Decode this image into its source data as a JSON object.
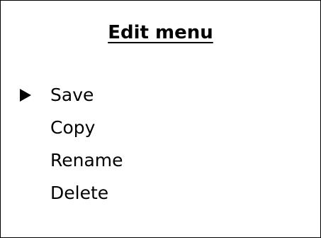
{
  "menu": {
    "title": "Edit menu",
    "selected_index": 0,
    "cursor_icon": "right-triangle-pointer",
    "items": [
      {
        "label": "Save"
      },
      {
        "label": "Copy"
      },
      {
        "label": "Rename"
      },
      {
        "label": "Delete"
      }
    ]
  },
  "colors": {
    "text": "#000000",
    "background": "#ffffff",
    "border": "#000000"
  }
}
